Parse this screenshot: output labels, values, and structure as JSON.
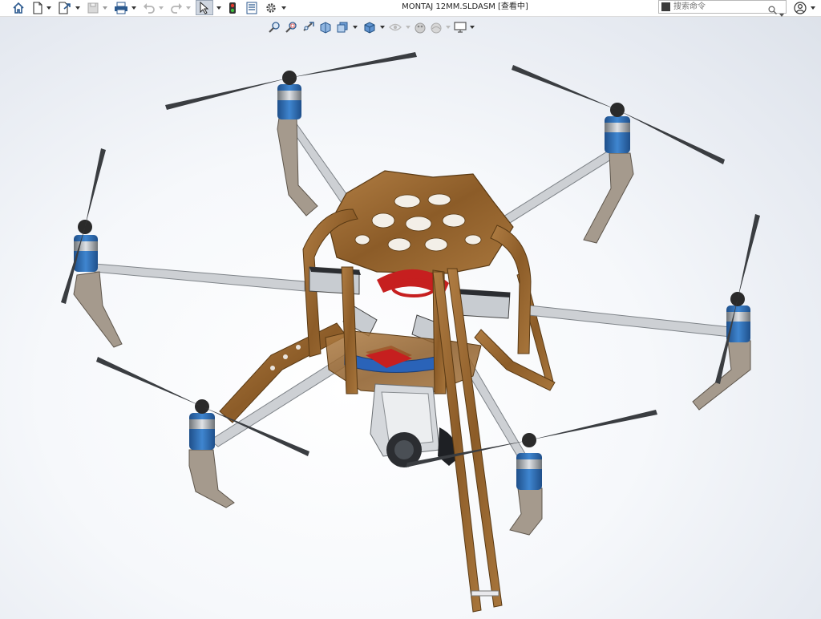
{
  "window": {
    "title": "MONTAJ 12MM.SLDASM [查看中]"
  },
  "toolbar": {
    "items": [
      {
        "name": "home-icon"
      },
      {
        "name": "new-document-icon"
      },
      {
        "name": "open-document-icon"
      },
      {
        "name": "save-icon"
      },
      {
        "name": "print-icon"
      },
      {
        "name": "undo-icon"
      },
      {
        "name": "redo-icon"
      },
      {
        "name": "select-cursor-icon"
      },
      {
        "name": "rebuild-traffic-light-icon"
      },
      {
        "name": "file-properties-icon"
      },
      {
        "name": "options-gear-icon"
      }
    ]
  },
  "search": {
    "placeholder": "搜索命令"
  },
  "heads_up_view": {
    "items": [
      "zoom-to-fit-icon",
      "zoom-to-area-icon",
      "previous-view-icon",
      "section-view-icon",
      "view-orientation-icon",
      "display-style-icon",
      "hide-show-items-icon",
      "edit-appearance-icon",
      "apply-scene-icon",
      "view-settings-icon"
    ]
  },
  "colors": {
    "wood": "#9a6a33",
    "wood_dark": "#6e4518",
    "arm": "#cdd0d4",
    "arm_edge": "#7e8388",
    "motor": "#2f6fb5",
    "prop": "#3a3d41",
    "landing_gear": "#a59a8d",
    "battery": "#c8ccd1",
    "battery_top": "#2b2d31",
    "red": "#c61f1f",
    "camera": "#d5d8dc"
  }
}
